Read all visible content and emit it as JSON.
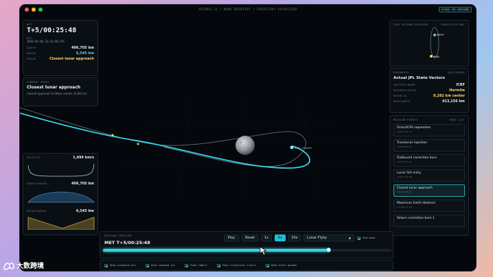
{
  "window": {
    "title": "ARTEMIS II / MOON INTERCEPT / TRAJECTORY VISUALIZER",
    "badge": "ACTUAL JPL HORIZONS"
  },
  "mission_clock": {
    "label": "MET",
    "met": "T+5/00:25:48",
    "utc_label": "UTC",
    "utc": "2026-04-06 23:31:06 UTC",
    "earth_label": "EARTH",
    "earth_value": "406,705 km",
    "moon_label": "MOON",
    "moon_value": "6,545 km",
    "phase_label": "PHASE",
    "phase_value": "Closest lunar approach"
  },
  "current_event": {
    "label": "CURRENT EVENT",
    "title": "Closest lunar approach",
    "desc": "Closest approach to Moon center: 8,282 km"
  },
  "charts": [
    {
      "label": "VELOCITY",
      "value": "1,494 km/s"
    },
    {
      "label": "EARTH RANGE",
      "value": "406,705 km"
    },
    {
      "label": "MOON RANGE",
      "value": "6,545 km"
    }
  ],
  "overview": {
    "label": "FREE-RETURN OVERVIEW",
    "label_right": "SIMPLIFIED MAP",
    "earth": "EARTH",
    "moon": "MOON"
  },
  "ephemeris": {
    "label": "EPHEMERIS",
    "label_right": "DISCLAIMER",
    "title": "Actual JPL State Vectors",
    "rows": [
      [
        "VECTOR FRAME",
        "ICRF"
      ],
      [
        "INTERPOLATION",
        "Hermite"
      ],
      [
        "MOON CA",
        "8,282 km center"
      ],
      [
        "MAX EARTH",
        "413,156 km"
      ]
    ]
  },
  "mission_events": {
    "label": "MISSION EVENTS",
    "label_right": "MARK LIST",
    "items": [
      {
        "name": "Orion/ICPS separation",
        "time": "T+0/03:25:12"
      },
      {
        "name": "Translunar injection",
        "time": "T+1/01:09:47"
      },
      {
        "name": "Outbound correction burn",
        "time": "T+2/07:45:02"
      },
      {
        "name": "Lunar SOI entry",
        "time": "T+4/17:18:40"
      },
      {
        "name": "Closest lunar approach",
        "time": "T+5/00:25:48"
      },
      {
        "name": "Maximum Earth distance",
        "time": "T+5/02:11:04"
      },
      {
        "name": "Return correction burn 1",
        "time": ""
      }
    ]
  },
  "playback": {
    "label": "MISSION TIMELINE",
    "met": "MET T+5/00:25:48",
    "play": "Play",
    "reset": "Reset",
    "speeds": [
      "1x",
      "5x",
      "20x"
    ],
    "active_speed": "5x",
    "preset": "Lunar Flyby",
    "true_scale": "True scale",
    "progress": 0.78
  },
  "options": [
    "Show outbound arc",
    "Show inbound arc",
    "Show labels",
    "Show trajectory trails",
    "Show orbit guides"
  ],
  "scene": {
    "marker_label": "Moon closest",
    "earth_marker": "Earth arc"
  },
  "watermark": {
    "text": "大数跨境"
  }
}
